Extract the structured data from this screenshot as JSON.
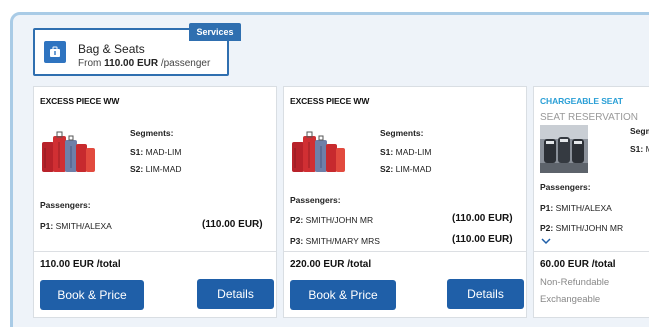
{
  "services": {
    "tab_label": "Services",
    "title": "Bag & Seats",
    "from_prefix": "From",
    "price": "110.00 EUR",
    "per": "/passenger",
    "icon": "luggage-icon"
  },
  "cards": [
    {
      "title": "EXCESS PIECE WW",
      "segments_label": "Segments:",
      "segments": [
        {
          "key": "S1:",
          "value": "MAD-LIM"
        },
        {
          "key": "S2:",
          "value": "LIM-MAD"
        }
      ],
      "passengers_label": "Passengers:",
      "passengers": [
        {
          "key": "P1:",
          "value": "SMITH/ALEXA",
          "price": "(110.00 EUR)"
        }
      ],
      "total": "110.00 EUR /total",
      "book_label": "Book & Price",
      "details_label": "Details"
    },
    {
      "title": "EXCESS PIECE WW",
      "segments_label": "Segments:",
      "segments": [
        {
          "key": "S1:",
          "value": "MAD-LIM"
        },
        {
          "key": "S2:",
          "value": "LIM-MAD"
        }
      ],
      "passengers_label": "Passengers:",
      "passengers": [
        {
          "key": "P2:",
          "value": "SMITH/JOHN MR",
          "price": "(110.00 EUR)"
        },
        {
          "key": "P3:",
          "value": "SMITH/MARY MRS",
          "price": "(110.00 EUR)"
        }
      ],
      "total": "220.00 EUR /total",
      "book_label": "Book & Price",
      "details_label": "Details"
    },
    {
      "title": "CHARGEABLE SEAT",
      "subtitle": "SEAT RESERVATION",
      "segments_label": "Segm",
      "segments": [
        {
          "key": "S1:",
          "value": "M"
        }
      ],
      "passengers_label": "Passengers:",
      "passengers": [
        {
          "key": "P1:",
          "value": "SMITH/ALEXA"
        },
        {
          "key": "P2:",
          "value": "SMITH/JOHN MR"
        }
      ],
      "total": "60.00 EUR /total",
      "condition_1": "Non-Refundable",
      "condition_2": "Exchangeable"
    }
  ],
  "colors": {
    "primary": "#1f5fa8",
    "accent": "#2a9fd6",
    "frame": "#a9cbe6"
  }
}
